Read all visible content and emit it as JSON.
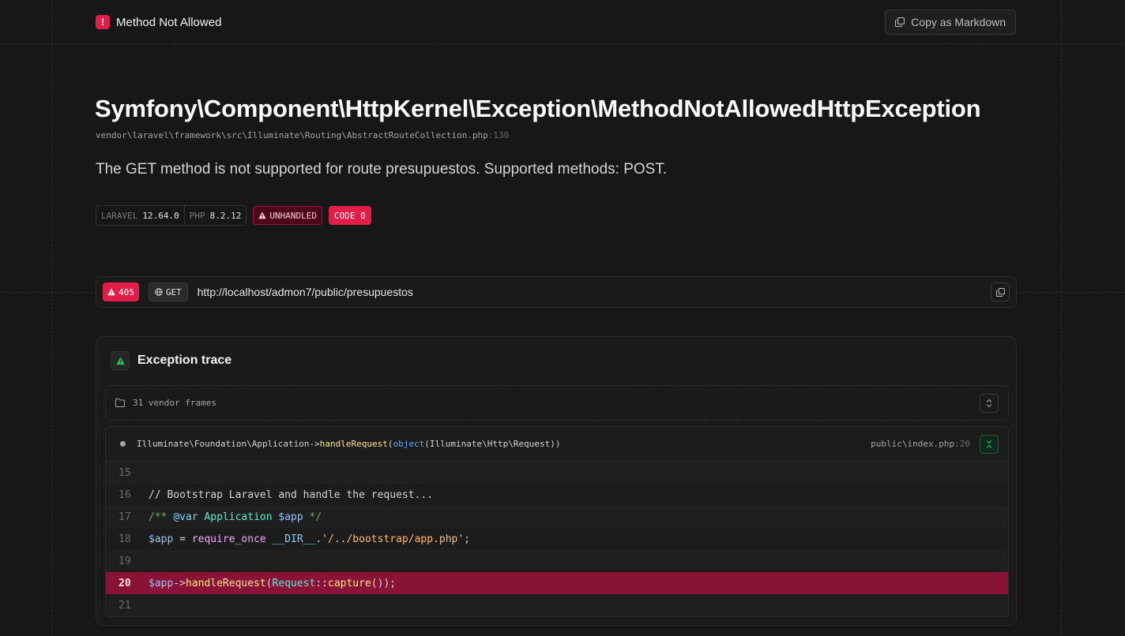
{
  "header": {
    "badge_icon": "exclamation",
    "title": "Method Not Allowed",
    "copy_button": "Copy as Markdown"
  },
  "exception": {
    "class": "Symfony\\Component\\HttpKernel\\Exception\\MethodNotAllowedHttpException",
    "file": "vendor\\laravel\\framework\\src\\Illuminate\\Routing\\AbstractRouteCollection.php",
    "line": ":130",
    "message": "The GET method is not supported for route presupuestos. Supported methods: POST."
  },
  "badges": {
    "laravel_label": "LARAVEL",
    "laravel_version": "12.64.0",
    "php_label": "PHP",
    "php_version": "8.2.12",
    "unhandled": "UNHANDLED",
    "code": "CODE 0"
  },
  "request": {
    "status": "405",
    "method": "GET",
    "url": "http://localhost/admon7/public/presupuestos"
  },
  "trace": {
    "title": "Exception trace",
    "vendor_frames": "31 vendor frames",
    "frame": {
      "class": "Illuminate\\Foundation\\Application->",
      "method": "handleRequest",
      "open": "(",
      "arg_kw": "object",
      "arg": "(Illuminate\\Http\\Request))",
      "file": "public\\index.php",
      "line": ":20"
    },
    "code_lines": [
      {
        "n": "15",
        "text": ""
      },
      {
        "n": "16",
        "text": "// Bootstrap Laravel and handle the request..."
      },
      {
        "n": "17",
        "text": "/** @var Application $app */"
      },
      {
        "n": "18",
        "text": "$app = require_once __DIR__.'/../bootstrap/app.php';"
      },
      {
        "n": "19",
        "text": ""
      },
      {
        "n": "20",
        "text": "$app->handleRequest(Request::capture());"
      },
      {
        "n": "21",
        "text": ""
      }
    ],
    "highlight_line": "20"
  },
  "colors": {
    "background": "#171717",
    "accent": "#e11d48",
    "highlight_row": "#881337"
  }
}
